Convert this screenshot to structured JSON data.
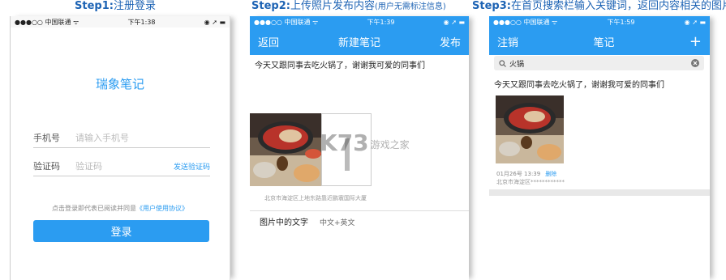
{
  "steps": [
    {
      "label": "Step1:",
      "text": "注册登录",
      "note": ""
    },
    {
      "label": "Step2:",
      "text": "上传照片发布内容",
      "note": "(用户无需标注信息)"
    },
    {
      "label": "Step3:",
      "text": "在首页搜索栏输入关键词，返回内容相关的图片"
    }
  ],
  "status": {
    "carrier": "●●●○○ 中国联通 ᯤ",
    "time1": "下午1:38",
    "time2": "下午1:39",
    "time3": "下午1:59",
    "right": "◉ ➚ ▬"
  },
  "login": {
    "app_title": "瑞象笔记",
    "phone_label": "手机号",
    "phone_placeholder": "请输入手机号",
    "code_label": "验证码",
    "code_placeholder": "验证码",
    "send_code": "发送验证码",
    "agreement": "点击登录即代表已阅读并同意",
    "agreement_link": "《用户使用协议》",
    "login_button": "登录"
  },
  "new_note": {
    "back": "返回",
    "title": "新建笔记",
    "publish": "发布",
    "text": "今天又跟同事去吃火锅了，谢谢我可爱的同事们",
    "location": "北京市海淀区上地东路靠近鹏寰国际大厦",
    "ocr_label": "图片中的文字",
    "ocr_value": "中文+英文",
    "watermark": "K73",
    "watermark_sub": "游戏之家"
  },
  "notes": {
    "logout": "注销",
    "title": "笔记",
    "add": "+",
    "query": "火锅",
    "result_text": "今天又跟同事去吃火锅了，谢谢我可爱的同事们",
    "date": "01月26号 13:39",
    "delete": "删除",
    "location": "北京市海淀区************"
  }
}
